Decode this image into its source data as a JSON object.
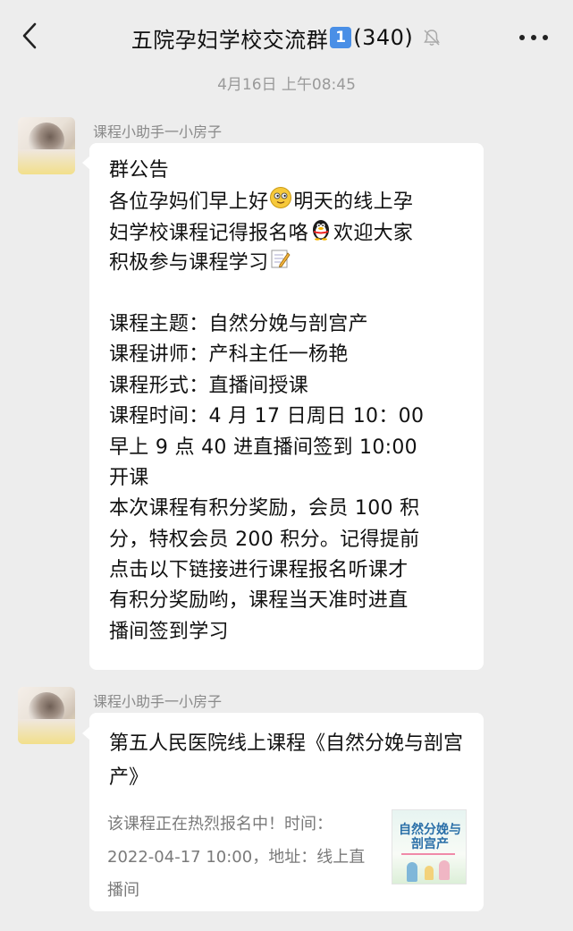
{
  "header": {
    "title": "五院孕妇学校交流群",
    "badge": "1",
    "count": "(340)"
  },
  "timestamp": "4月16日 上午08:45",
  "messages": [
    {
      "sender": "课程小助手一小房子",
      "lines": [
        "群公告",
        "各位孕妈们早上好",
        "明天的线上孕",
        "妇学校课程记得报名咯",
        "欢迎大家",
        "积极参与课程学习",
        "",
        "课程主题：自然分娩与剖宫产",
        "课程讲师：产科主任一杨艳",
        "课程形式：直播间授课",
        "课程时间：4 月 17 日周日 10：00",
        "早上 9 点 40 进直播间签到   10:00",
        "开课",
        "本次课程有积分奖励，会员 100 积",
        "分，特权会员 200 积分。记得提前",
        "点击以下链接进行课程报名听课才",
        "有积分奖励哟，课程当天准时进直",
        "播间签到学习"
      ]
    },
    {
      "sender": "课程小助手一小房子",
      "card": {
        "title": "第五人民医院线上课程《自然分娩与剖宫产》",
        "description": "该课程正在热烈报名中！时间：2022-04-17 10:00，地址：线上直播间",
        "thumb_text": "自然分娩与剖宫产"
      }
    }
  ],
  "icons": [
    "back-arrow-icon",
    "mute-bell-icon",
    "more-icon",
    "smile-emoji-icon",
    "penguin-emoji-icon",
    "memo-emoji-icon"
  ]
}
